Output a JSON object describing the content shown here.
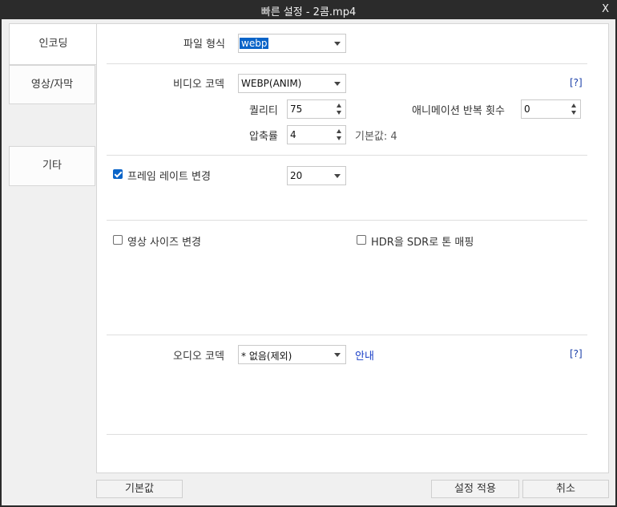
{
  "window": {
    "title": "빠른 설정 - 2콤.mp4",
    "close_label": "X"
  },
  "sidebar": {
    "items": [
      {
        "label": "인코딩"
      },
      {
        "label": "영상/자막"
      },
      {
        "label": "기타"
      }
    ]
  },
  "encoding": {
    "file_format_label": "파일 형식",
    "file_format_value": "webp",
    "video_codec_label": "비디오 코덱",
    "video_codec_value": "WEBP(ANIM)",
    "help_link": "[?]",
    "quality_label": "퀄리티",
    "quality_value": "75",
    "loop_label": "애니메이션 반복 횟수",
    "loop_value": "0",
    "compression_label": "압축률",
    "compression_value": "4",
    "compression_default": "기본값: 4",
    "framerate_label": "프레임 레이트 변경",
    "framerate_checked": true,
    "framerate_value": "20",
    "resize_label": "영상 사이즈 변경",
    "resize_checked": false,
    "hdr_label": "HDR을 SDR로 톤 매핑",
    "hdr_checked": false,
    "audio_codec_label": "오디오 코덱",
    "audio_codec_value": "* 없음(제외)",
    "audio_info_link": "안내",
    "audio_help_link": "[?]"
  },
  "footer": {
    "default_label": "기본값",
    "apply_label": "설정 적용",
    "cancel_label": "취소"
  },
  "colors": {
    "accent": "#0a64c8",
    "link": "#1a3fa8",
    "titlebar": "#2b2b2b"
  }
}
